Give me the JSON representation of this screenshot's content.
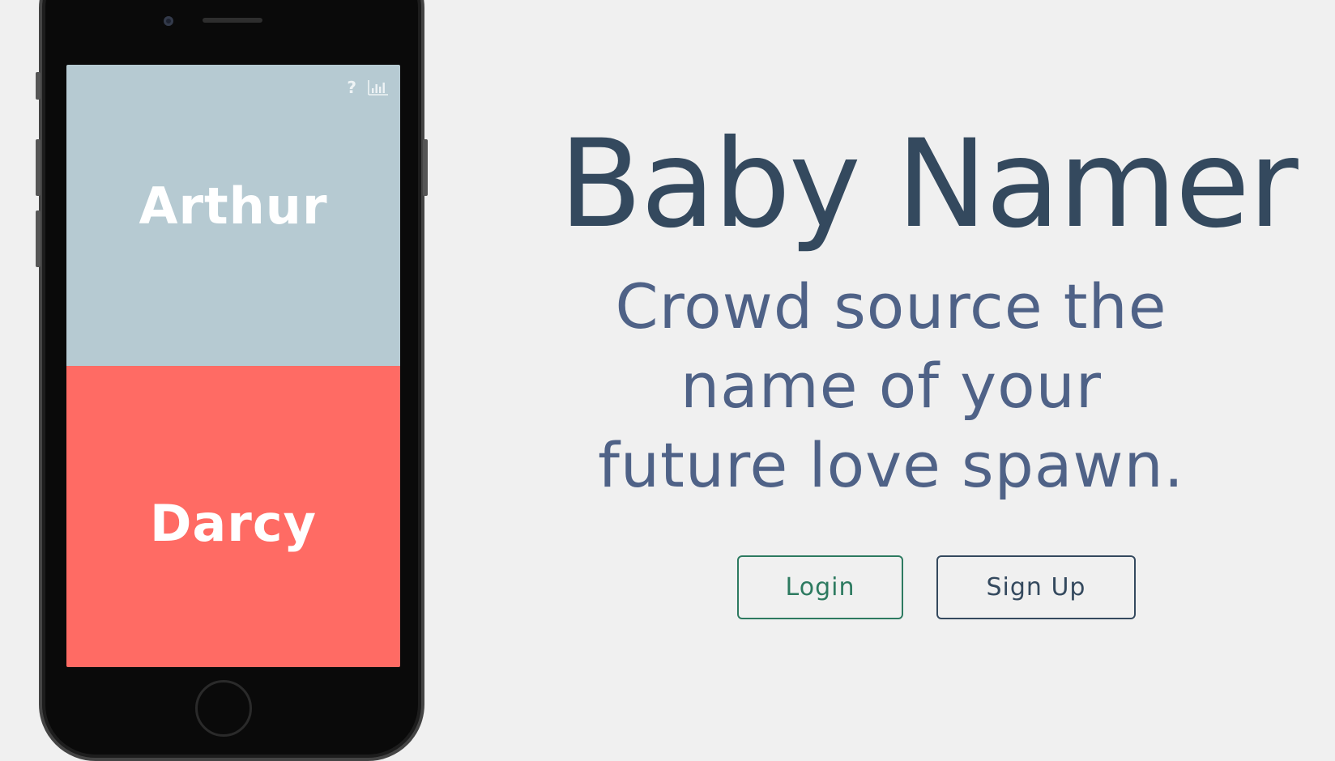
{
  "app": {
    "title": "Baby Namer",
    "tagline": "Crowd source the name of your future love spawn."
  },
  "actions": {
    "login_label": "Login",
    "signup_label": "Sign Up"
  },
  "phone_screen": {
    "help_icon_glyph": "?",
    "names": {
      "top": "Arthur",
      "bottom": "Darcy"
    },
    "icons": [
      "help-icon",
      "stats-icon"
    ]
  },
  "colors": {
    "page_background": "#f0f0f0",
    "title": "#34495e",
    "tagline": "#4f6287",
    "login_accent": "#2d7a60",
    "signup_accent": "#34495e",
    "top_name_panel": "#b6cad2",
    "bottom_name_panel": "#ff6b64"
  }
}
